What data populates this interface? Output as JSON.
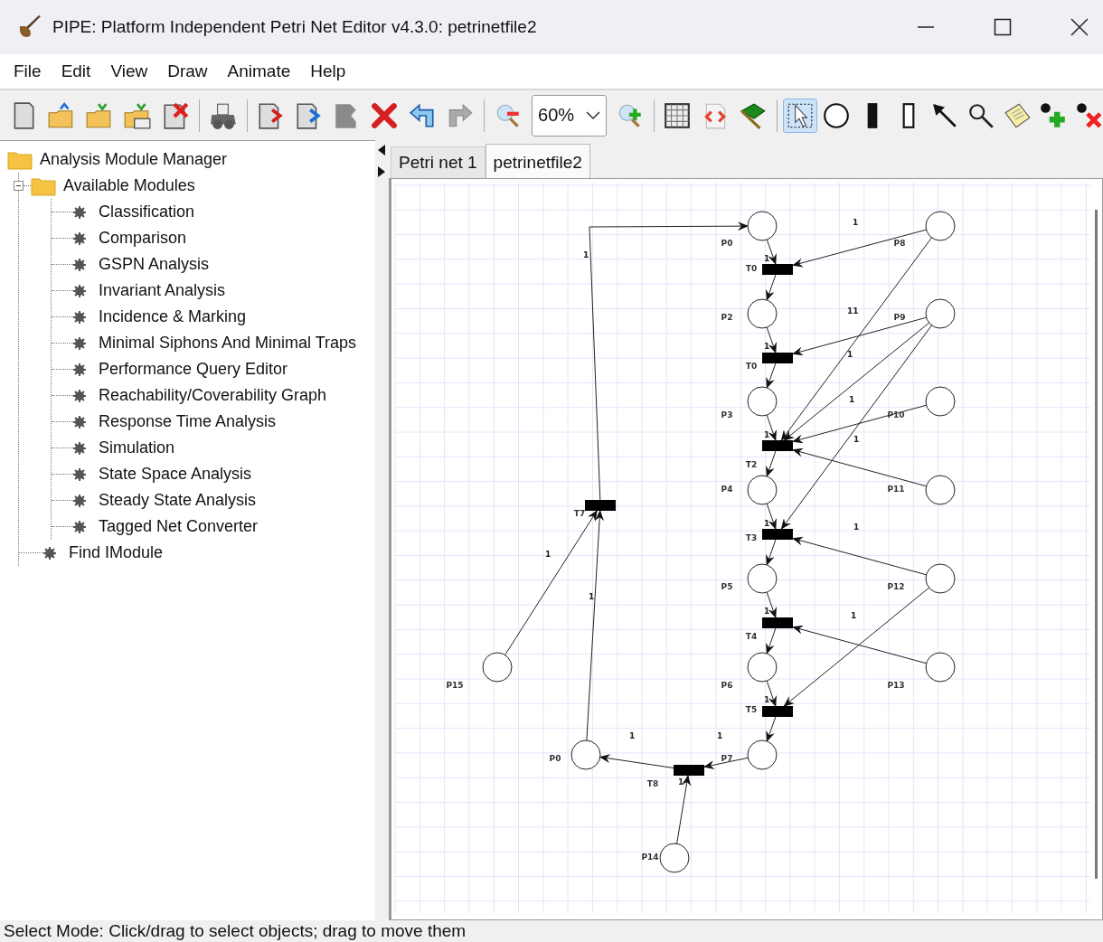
{
  "window": {
    "title": "PIPE: Platform Independent Petri Net Editor v4.3.0: petrinetfile2"
  },
  "menu": [
    "File",
    "Edit",
    "View",
    "Draw",
    "Animate",
    "Help"
  ],
  "toolbar": {
    "zoom": "60%",
    "mode_tools": [
      {
        "selected": true
      },
      {
        "selected": false
      },
      {
        "selected": false
      },
      {
        "selected": false
      },
      {
        "selected": false
      },
      {
        "selected": false
      },
      {
        "selected": false
      },
      {
        "selected": false
      },
      {
        "selected": false
      }
    ]
  },
  "module_tree": {
    "label": "Analysis Module Manager",
    "children": [
      {
        "label": "Available Modules",
        "expanded": true,
        "children": [
          {
            "label": "Classification"
          },
          {
            "label": "Comparison"
          },
          {
            "label": "GSPN Analysis"
          },
          {
            "label": "Invariant Analysis"
          },
          {
            "label": "Incidence & Marking"
          },
          {
            "label": "Minimal Siphons And Minimal Traps"
          },
          {
            "label": "Performance Query Editor"
          },
          {
            "label": "Reachability/Coverability Graph"
          },
          {
            "label": "Response Time Analysis"
          },
          {
            "label": "Simulation"
          },
          {
            "label": "State Space Analysis"
          },
          {
            "label": "Steady State Analysis"
          },
          {
            "label": "Tagged Net Converter"
          }
        ]
      },
      {
        "label": "Find IModule"
      }
    ]
  },
  "tabs": [
    {
      "label": "Petri net 1",
      "selected": false
    },
    {
      "label": "petrinetfile2",
      "selected": true
    }
  ],
  "net": {
    "places": [
      {
        "label": "P0"
      },
      {
        "label": "P8"
      },
      {
        "label": "P2"
      },
      {
        "label": "P9"
      },
      {
        "label": "P3"
      },
      {
        "label": "P10"
      },
      {
        "label": "P4"
      },
      {
        "label": "P11"
      },
      {
        "label": "P5"
      },
      {
        "label": "P12"
      },
      {
        "label": "P15"
      },
      {
        "label": "P6"
      },
      {
        "label": "P13"
      },
      {
        "label": "P0"
      },
      {
        "label": "P7"
      },
      {
        "label": "P14"
      }
    ],
    "transitions": [
      {
        "label": "T0"
      },
      {
        "label": "T0"
      },
      {
        "label": "T2"
      },
      {
        "label": "T7"
      },
      {
        "label": "T3"
      },
      {
        "label": "T4"
      },
      {
        "label": "T5"
      },
      {
        "label": "T8"
      }
    ],
    "arc_weights": [
      "1",
      "1",
      "1",
      "11",
      "1",
      "1",
      "1",
      "1",
      "1",
      "1",
      "1",
      "1",
      "1",
      "1",
      "1",
      "1",
      "1",
      "1",
      "1"
    ]
  },
  "status_bar": "Select Mode: Click/drag to select objects; drag to move them"
}
